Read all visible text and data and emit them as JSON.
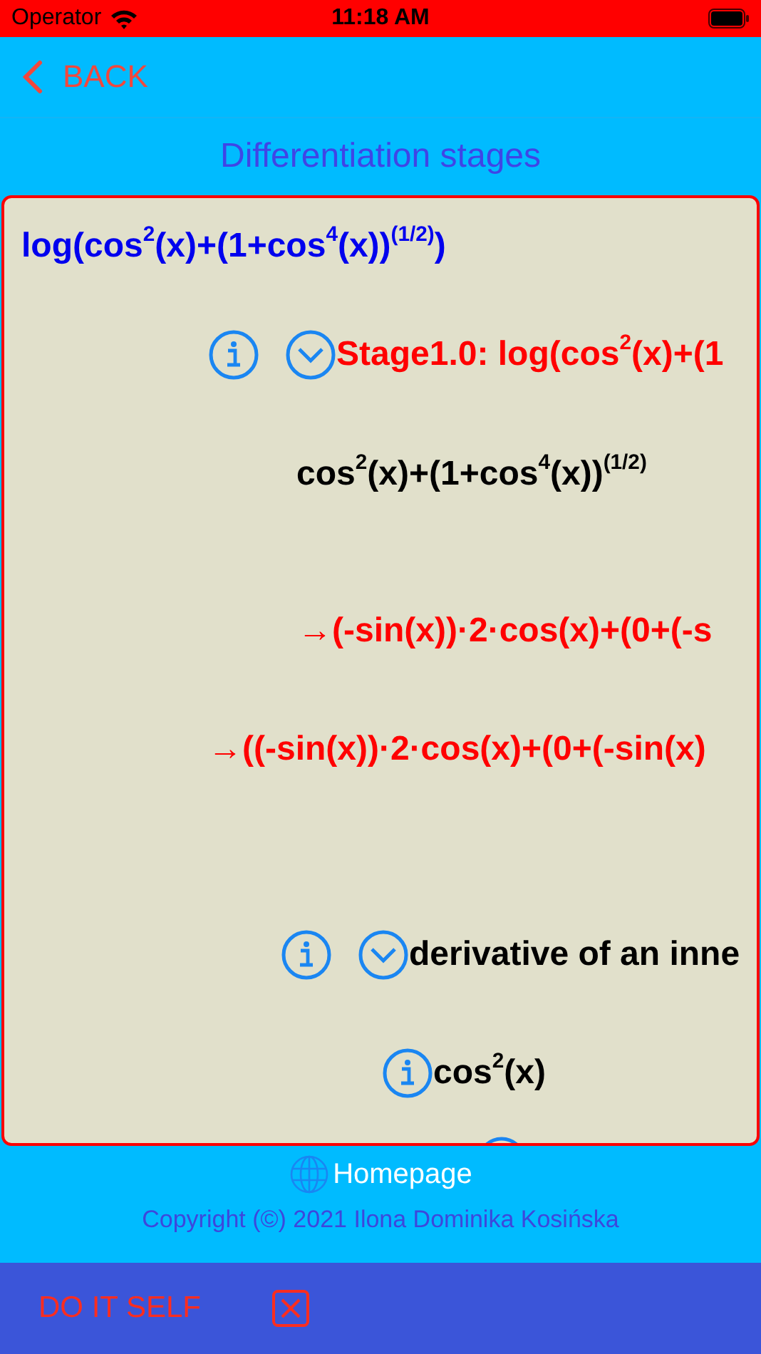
{
  "status_bar": {
    "carrier": "Operator",
    "time": "11:18 AM"
  },
  "nav": {
    "back": "BACK"
  },
  "title": "Differentiation stages",
  "rows": [
    {
      "kind": "expression",
      "text": "log(cos$^{2}$(x)+(1+cos$^{4}$(x))$^{(1/2)}$)",
      "color": "#0000ee"
    },
    {
      "kind": "stage",
      "text": "Stage1.0: log(cos$^{2}$(x)+(1",
      "color": "#ff0000",
      "expanded": true
    },
    {
      "kind": "expression",
      "text": "cos$^{2}$(x)+(1+cos$^{4}$(x))$^{(1/2)}$",
      "color": "#000000"
    },
    {
      "kind": "expression",
      "text": "→(-sin(x))·2·cos(x)+(0+(-s",
      "color": "#ff0000"
    },
    {
      "kind": "expression",
      "text": "→((-sin(x))·2·cos(x)+(0+(-sin(x)",
      "color": "#ff0000"
    },
    {
      "kind": "stage",
      "text": "derivative of an inne",
      "color": "#000000",
      "expanded": true
    },
    {
      "kind": "info",
      "text": "cos$^{2}$(x)",
      "color": "#000000"
    },
    {
      "kind": "info"
    }
  ],
  "footer": {
    "homepage": "Homepage",
    "copyright": "Copyright (©) 2021 Ilona Dominika Kosińska"
  },
  "bottom_bar": {
    "button": "DO IT SELF"
  }
}
